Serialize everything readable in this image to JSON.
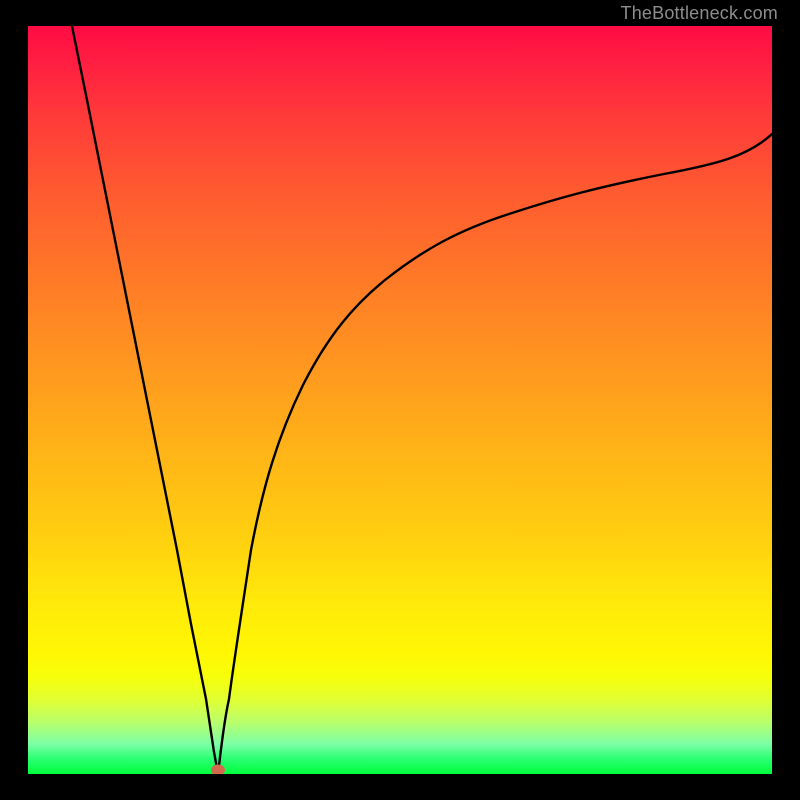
{
  "watermark": {
    "text": "TheBottleneck.com"
  },
  "chart_data": {
    "type": "line",
    "title": "",
    "xlabel": "",
    "ylabel": "",
    "xlim": [
      0,
      100
    ],
    "ylim": [
      0,
      100
    ],
    "grid": false,
    "legend": false,
    "series": [
      {
        "name": "bottleneck-curve-left",
        "x": [
          6,
          8,
          10,
          12,
          14,
          16,
          18,
          20,
          22,
          24,
          25,
          25.5
        ],
        "y": [
          100,
          90,
          80,
          70,
          60,
          50,
          40,
          30,
          20,
          10,
          3,
          0
        ]
      },
      {
        "name": "bottleneck-curve-right",
        "x": [
          25.5,
          26,
          27,
          28,
          30,
          33,
          37,
          42,
          48,
          55,
          63,
          72,
          82,
          92,
          100
        ],
        "y": [
          0,
          3,
          10,
          18,
          30,
          42,
          52,
          60,
          66,
          71,
          75,
          78.5,
          81.5,
          84,
          85.5
        ]
      }
    ],
    "marker": {
      "name": "optimal-point",
      "x": 25.5,
      "y": 0,
      "color": "#d2694f"
    },
    "background_gradient": {
      "top": "#ff0b43",
      "mid": "#ffd10f",
      "bottom": "#00ff3d"
    },
    "frame_color": "#000000",
    "curve_color": "#000000"
  }
}
